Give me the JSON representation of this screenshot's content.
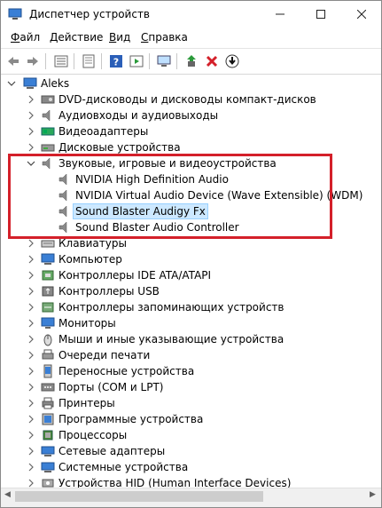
{
  "window": {
    "title": "Диспетчер устройств"
  },
  "menu": [
    {
      "pre": "",
      "ul": "Ф",
      "post": "айл"
    },
    {
      "pre": "",
      "ul": "Д",
      "post": "ействие"
    },
    {
      "pre": "",
      "ul": "В",
      "post": "ид"
    },
    {
      "pre": "",
      "ul": "С",
      "post": "правка"
    }
  ],
  "tree": {
    "root": "Aleks",
    "items": [
      {
        "label": "DVD-дисководы и дисководы компакт-дисков",
        "icon": "dvd-drive-icon"
      },
      {
        "label": "Аудиовходы и аудиовыходы",
        "icon": "speaker-icon"
      },
      {
        "label": "Видеоадаптеры",
        "icon": "display-adapter-icon"
      },
      {
        "label": "Дисковые устройства",
        "icon": "disk-drive-icon"
      },
      {
        "label": "Звуковые, игровые и видеоустройства",
        "icon": "speaker-icon",
        "expanded": true,
        "children": [
          {
            "label": "NVIDIA High Definition Audio"
          },
          {
            "label": "NVIDIA Virtual Audio Device (Wave Extensible) (WDM)"
          },
          {
            "label": "Sound Blaster Audigy Fx",
            "selected": true
          },
          {
            "label": "Sound Blaster Audio Controller"
          }
        ]
      },
      {
        "label": "Клавиатуры",
        "icon": "keyboard-icon"
      },
      {
        "label": "Компьютер",
        "icon": "computer-icon"
      },
      {
        "label": "Контроллеры IDE ATA/ATAPI",
        "icon": "ide-controller-icon"
      },
      {
        "label": "Контроллеры USB",
        "icon": "usb-icon"
      },
      {
        "label": "Контроллеры запоминающих устройств",
        "icon": "storage-controller-icon"
      },
      {
        "label": "Мониторы",
        "icon": "monitor-icon"
      },
      {
        "label": "Мыши и иные указывающие устройства",
        "icon": "mouse-icon"
      },
      {
        "label": "Очереди печати",
        "icon": "print-queue-icon"
      },
      {
        "label": "Переносные устройства",
        "icon": "portable-device-icon"
      },
      {
        "label": "Порты (COM и LPT)",
        "icon": "port-icon"
      },
      {
        "label": "Принтеры",
        "icon": "printer-icon"
      },
      {
        "label": "Программные устройства",
        "icon": "software-device-icon"
      },
      {
        "label": "Процессоры",
        "icon": "processor-icon"
      },
      {
        "label": "Сетевые адаптеры",
        "icon": "network-adapter-icon"
      },
      {
        "label": "Системные устройства",
        "icon": "system-device-icon"
      },
      {
        "label": "Устройства HID (Human Interface Devices)",
        "icon": "hid-icon"
      }
    ]
  }
}
